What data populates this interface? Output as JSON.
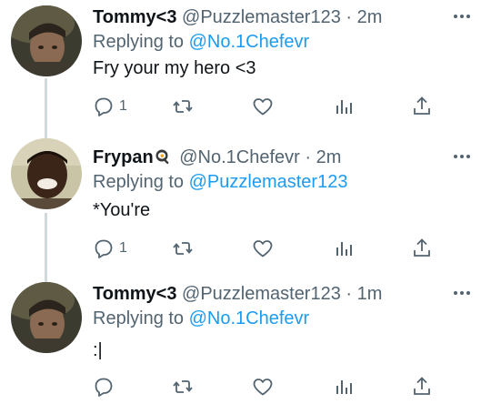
{
  "colors": {
    "text": "#0f1419",
    "secondary": "#536471",
    "link": "#1d9bf0",
    "thread_line": "#cfd9de"
  },
  "tweets": [
    {
      "display_name": "Tommy<3",
      "name_emoji": "",
      "handle": "@Puzzlemaster123",
      "separator": "·",
      "time": "2m",
      "reply_prefix": "Replying to",
      "reply_to": "@No.1Chefevr",
      "text": "Fry your my hero <3",
      "reply_count": "1",
      "retweet_count": "",
      "like_count": "",
      "avatar_icon": "avatar-photo"
    },
    {
      "display_name": "Frypan",
      "name_emoji": "frying-pan-egg-emoji",
      "handle": "@No.1Chefevr",
      "separator": "·",
      "time": "2m",
      "reply_prefix": "Replying to",
      "reply_to": "@Puzzlemaster123",
      "text": "*You're",
      "reply_count": "1",
      "retweet_count": "",
      "like_count": "",
      "avatar_icon": "avatar-photo"
    },
    {
      "display_name": "Tommy<3",
      "name_emoji": "",
      "handle": "@Puzzlemaster123",
      "separator": "·",
      "time": "1m",
      "reply_prefix": "Replying to",
      "reply_to": "@No.1Chefevr",
      "text": ":|",
      "reply_count": "",
      "retweet_count": "",
      "like_count": "",
      "avatar_icon": "avatar-photo"
    }
  ],
  "icons": {
    "more": "more-options-icon",
    "reply": "reply-icon",
    "retweet": "retweet-icon",
    "like": "like-icon",
    "analytics": "analytics-icon",
    "share": "share-icon"
  }
}
